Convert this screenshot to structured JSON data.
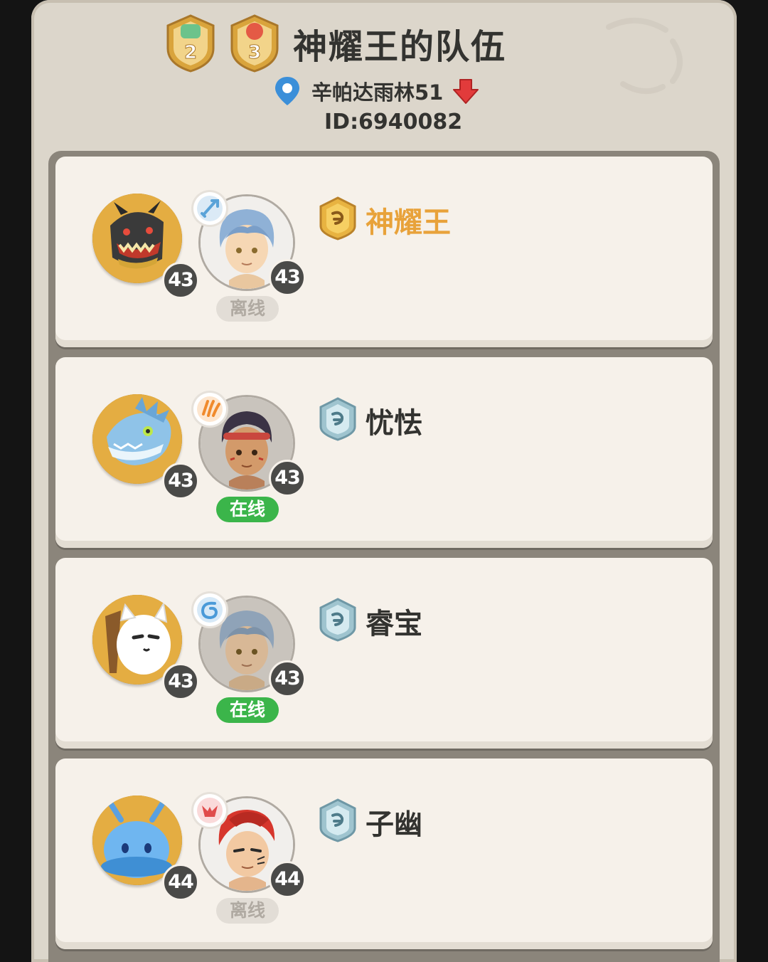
{
  "header": {
    "badges": [
      {
        "icon": "rank-badge-2-icon",
        "number": "2",
        "color": "#6cc38b"
      },
      {
        "icon": "rank-badge-3-icon",
        "number": "3",
        "color": "#e45a45"
      }
    ],
    "title": "神耀王的队伍",
    "location": "辛帕达雨林51",
    "location_icon": "map-pin-icon",
    "down_icon": "down-arrow-icon",
    "team_id": "ID:6940082"
  },
  "members": [
    {
      "name": "神耀王",
      "role": "leader",
      "rank_color": "#e8b341",
      "pet_icon": "black-dragon-pet-icon",
      "pet_level": "43",
      "class_icon": "sword-class-icon",
      "class_color": "#5aa3d8",
      "player_level": "43",
      "status": "离线",
      "online": false
    },
    {
      "name": "忧怯",
      "role": "member",
      "rank_color": "#9fc4cf",
      "pet_icon": "ice-dragon-pet-icon",
      "pet_level": "43",
      "class_icon": "claw-class-icon",
      "class_color": "#f08a2c",
      "player_level": "43",
      "status": "在线",
      "online": true
    },
    {
      "name": "睿宝",
      "role": "member",
      "rank_color": "#9fc4cf",
      "pet_icon": "white-cat-pet-icon",
      "pet_level": "43",
      "class_icon": "swirl-class-icon",
      "class_color": "#4a9ad8",
      "player_level": "43",
      "status": "在线",
      "online": true
    },
    {
      "name": "子幽",
      "role": "member",
      "rank_color": "#9fc4cf",
      "pet_icon": "blue-slime-pet-icon",
      "pet_level": "44",
      "class_icon": "fang-class-icon",
      "class_color": "#e04b4b",
      "player_level": "44",
      "status": "离线",
      "online": false
    }
  ]
}
